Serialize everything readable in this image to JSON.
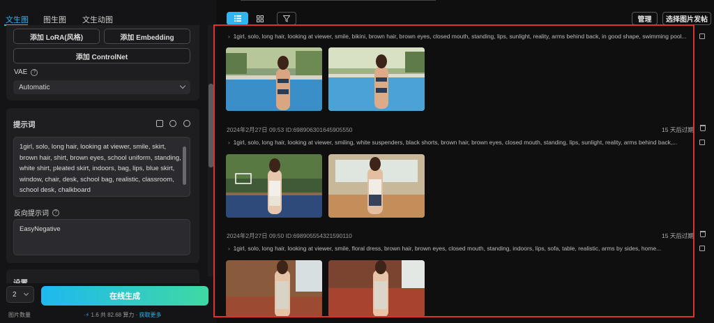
{
  "tabs": [
    "文生图",
    "图生图",
    "文生动图"
  ],
  "buttons": {
    "add_lora": "添加 LoRA(风格)",
    "add_embedding": "添加 Embedding",
    "add_controlnet": "添加 ControlNet"
  },
  "vae": {
    "label": "VAE",
    "value": "Automatic"
  },
  "prompt": {
    "label": "提示词",
    "text": "1girl, solo, long hair, looking at viewer, smile, skirt, brown hair, shirt, brown eyes, school uniform, standing, white shirt, pleated skirt, indoors, bag, lips, blue skirt, window, chair, desk, school bag, realistic, classroom, school desk, chalkboard"
  },
  "negative_prompt": {
    "label": "反向提示词",
    "text": "EasyNegative"
  },
  "settings_label": "设置",
  "count": {
    "value": "2",
    "label": "图片数量"
  },
  "generate_label": "在线生成",
  "cost": {
    "amount": "1.6",
    "total_text": "共 82.68 算力",
    "more": "获取更多"
  },
  "top": {
    "manage": "管理",
    "select_post": "选择图片发帖"
  },
  "entries": [
    {
      "meta": "",
      "expire": "",
      "prompt": "1girl, solo, long hair, looking at viewer, smile, bikini, brown hair, brown eyes, closed mouth, standing, lips, sunlight, reality, arms behind back, in good shape, swimming pool..."
    },
    {
      "meta": "2024年2月27日 09:53 ID:698906301645905550",
      "expire": "15 天后过期",
      "prompt": "1girl, solo, long hair, looking at viewer, smiling, white suspenders, black shorts, brown hair, brown eyes, closed mouth, standing, lips, sunlight, reality, arms behind back,..."
    },
    {
      "meta": "2024年2月27日 09:50 ID:698905554321590110",
      "expire": "15 天后过期",
      "prompt": "1girl, solo, long hair, looking at viewer, smile, floral dress, brown hair, brown eyes, closed mouth, standing, indoors, lips, sofa, table, realistic, arms by sides, home..."
    }
  ]
}
